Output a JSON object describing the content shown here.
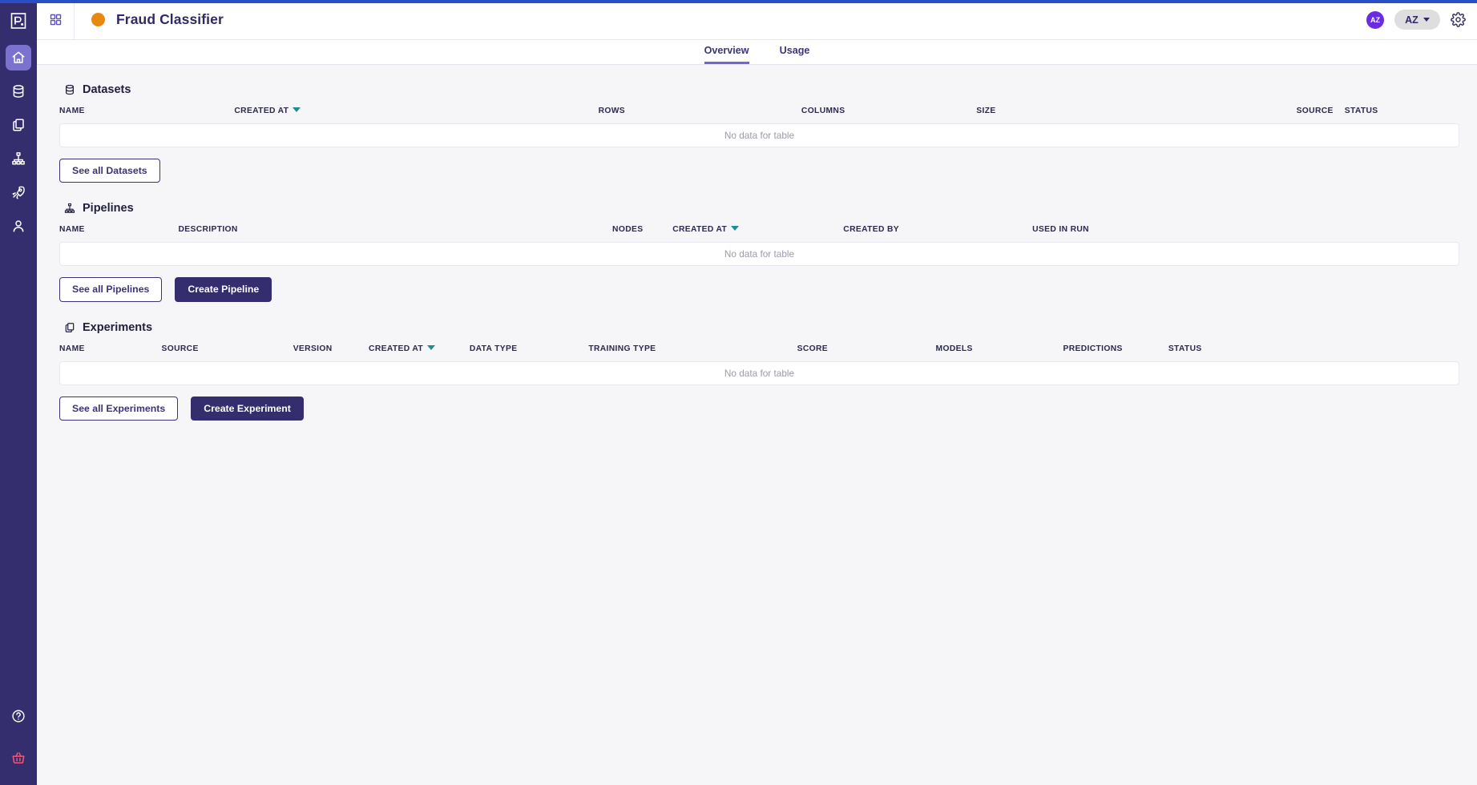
{
  "app": {
    "logo_icon": "platform-logo-icon",
    "accent_purple": "#342d6e",
    "accent_blue": "#2b4ec4",
    "project_dot_color": "#e8880f",
    "avatar_color": "#6a2ce0"
  },
  "sidebar": {
    "items": [
      {
        "icon": "home-icon",
        "name": "home",
        "active": true
      },
      {
        "icon": "database-icon",
        "name": "datasets",
        "active": false
      },
      {
        "icon": "copy-icon",
        "name": "experiments",
        "active": false
      },
      {
        "icon": "hierarchy-icon",
        "name": "pipelines",
        "active": false
      },
      {
        "icon": "rocket-icon",
        "name": "deployments",
        "active": false
      },
      {
        "icon": "user-icon",
        "name": "account",
        "active": false
      }
    ],
    "bottom_items": [
      {
        "icon": "help-circle-icon",
        "name": "help"
      },
      {
        "icon": "basket-icon",
        "name": "basket",
        "color": "#f4587a"
      }
    ]
  },
  "header": {
    "grid_icon": "grid-apps-icon",
    "project_title": "Fraud Classifier",
    "avatar_initials": "AZ",
    "org_label": "AZ",
    "gear_icon": "gear-icon"
  },
  "tabs": [
    {
      "label": "Overview",
      "active": true
    },
    {
      "label": "Usage",
      "active": false
    }
  ],
  "sections": {
    "datasets": {
      "icon": "database-icon",
      "title": "Datasets",
      "columns": [
        "NAME",
        "CREATED AT",
        "ROWS",
        "COLUMNS",
        "SIZE",
        "SOURCE",
        "STATUS"
      ],
      "sorted_column": "CREATED AT",
      "empty_text": "No data for table",
      "rows": [],
      "buttons": [
        {
          "label": "See all Datasets",
          "style": "outline",
          "name": "see-all-datasets-button"
        }
      ]
    },
    "pipelines": {
      "icon": "hierarchy-icon",
      "title": "Pipelines",
      "columns": [
        "NAME",
        "DESCRIPTION",
        "NODES",
        "CREATED AT",
        "CREATED BY",
        "USED IN RUN"
      ],
      "sorted_column": "CREATED AT",
      "empty_text": "No data for table",
      "rows": [],
      "buttons": [
        {
          "label": "See all Pipelines",
          "style": "outline",
          "name": "see-all-pipelines-button"
        },
        {
          "label": "Create Pipeline",
          "style": "solid",
          "name": "create-pipeline-button"
        }
      ]
    },
    "experiments": {
      "icon": "copy-icon",
      "title": "Experiments",
      "columns": [
        "NAME",
        "SOURCE",
        "VERSION",
        "CREATED AT",
        "DATA TYPE",
        "TRAINING TYPE",
        "SCORE",
        "MODELS",
        "PREDICTIONS",
        "STATUS"
      ],
      "sorted_column": "CREATED AT",
      "empty_text": "No data for table",
      "rows": [],
      "buttons": [
        {
          "label": "See all Experiments",
          "style": "outline",
          "name": "see-all-experiments-button"
        },
        {
          "label": "Create Experiment",
          "style": "solid",
          "name": "create-experiment-button"
        }
      ]
    }
  }
}
